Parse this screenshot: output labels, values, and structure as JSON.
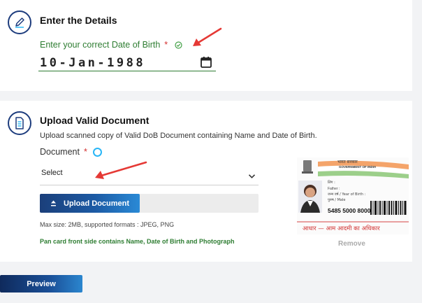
{
  "details": {
    "title": "Enter the Details",
    "dob_label": "Enter your correct Date of Birth",
    "required_mark": "*",
    "dob_value": "10-Jan-1988"
  },
  "upload": {
    "title": "Upload Valid Document",
    "subtitle": "Upload scanned copy of Valid DoB Document containing Name and Date of Birth.",
    "document_label": "Document",
    "required_mark": "*",
    "select_value": "Select",
    "upload_button": "Upload Document",
    "max_size": "Max size: 2MB, supported formats : JPEG, PNG",
    "note": "Pan card front side contains Name, Date of Birth and Photograph",
    "remove_label": "Remove"
  },
  "aadhaar_card": {
    "header": "भारत सरकार",
    "subheader": "GOVERNMENT OF INDIA",
    "line1": "लिंग :",
    "line2": "Father :",
    "line3": "जन्म वर्ष / Year of Birth :",
    "line4": "पुरुष / Male",
    "number": "5485 5000 8000",
    "footer": "आधार — आम आदमी का अधिकार"
  },
  "preview_button": "Preview",
  "colors": {
    "accent_green": "#2e7d32",
    "required_red": "#d32f2f",
    "brand_blue": "#1c5aa4",
    "arrow_red": "#e53935"
  },
  "icons": {
    "details_icon": "pen-icon",
    "upload_icon": "document-icon",
    "dob_check": "check-circle-icon",
    "calendar": "calendar-icon",
    "chevron": "chevron-down-icon",
    "upload": "upload-icon"
  }
}
